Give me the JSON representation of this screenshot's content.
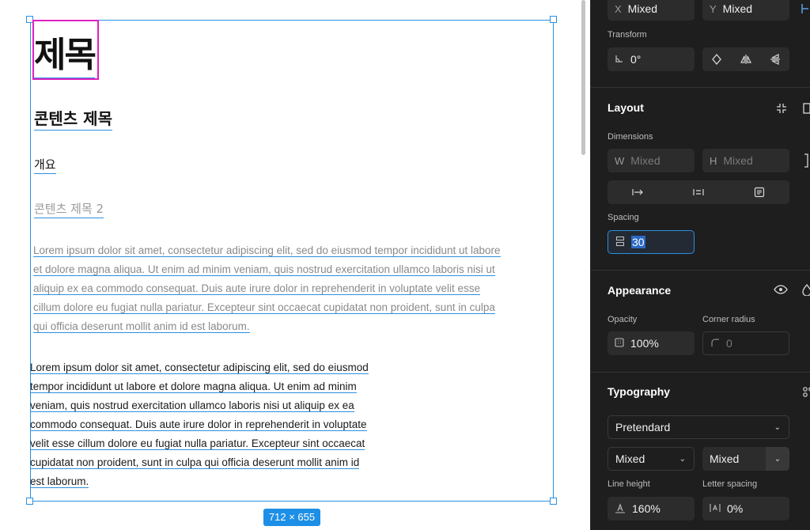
{
  "canvas": {
    "title": "제목",
    "content_title": "콘텐츠 제목",
    "overview": "개요",
    "content_title_2": "콘텐츠 제목 2",
    "paragraph1_lines": [
      "Lorem ipsum dolor sit amet, consectetur adipiscing elit, sed do eiusmod tempor incididunt ut labore",
      "et dolore magna aliqua. Ut enim ad minim veniam, quis nostrud exercitation ullamco laboris nisi ut",
      "aliquip ex ea commodo consequat. Duis aute irure dolor in reprehenderit in voluptate velit esse",
      "cillum dolore eu fugiat nulla pariatur. Excepteur sint occaecat cupidatat non proident, sunt in culpa",
      "qui officia deserunt mollit anim id est laborum."
    ],
    "paragraph2_lines": [
      "Lorem ipsum dolor sit amet, consectetur adipiscing elit, sed do eiusmod",
      "tempor incididunt ut labore et dolore magna aliqua. Ut enim ad minim",
      "veniam, quis nostrud exercitation ullamco laboris nisi ut aliquip ex ea",
      "commodo consequat. Duis aute irure dolor in reprehenderit in voluptate",
      "velit esse cillum dolore eu fugiat nulla pariatur. Excepteur sint occaecat",
      "cupidatat non proident, sunt in culpa qui officia deserunt mollit anim id",
      "est laborum."
    ],
    "selection_size": "712 × 655"
  },
  "panel": {
    "position": {
      "x_prefix": "X",
      "x_value": "Mixed",
      "y_prefix": "Y",
      "y_value": "Mixed"
    },
    "transform": {
      "label": "Transform",
      "rotation": "0°"
    },
    "layout": {
      "title": "Layout",
      "dimensions_label": "Dimensions",
      "w_prefix": "W",
      "w_value": "Mixed",
      "h_prefix": "H",
      "h_value": "Mixed",
      "spacing_label": "Spacing",
      "spacing_value": "30"
    },
    "appearance": {
      "title": "Appearance",
      "opacity_label": "Opacity",
      "opacity_value": "100%",
      "radius_label": "Corner radius",
      "radius_value": "0"
    },
    "typography": {
      "title": "Typography",
      "font_family": "Pretendard",
      "weight": "Mixed",
      "size": "Mixed",
      "line_height_label": "Line height",
      "line_height_value": "160%",
      "letter_spacing_label": "Letter spacing",
      "letter_spacing_value": "0%"
    }
  },
  "colors": {
    "selection": "#2b90e0",
    "title_highlight": "#e020c0",
    "panel_bg": "#1e1e1e",
    "field_bg": "#2c2c2c"
  }
}
